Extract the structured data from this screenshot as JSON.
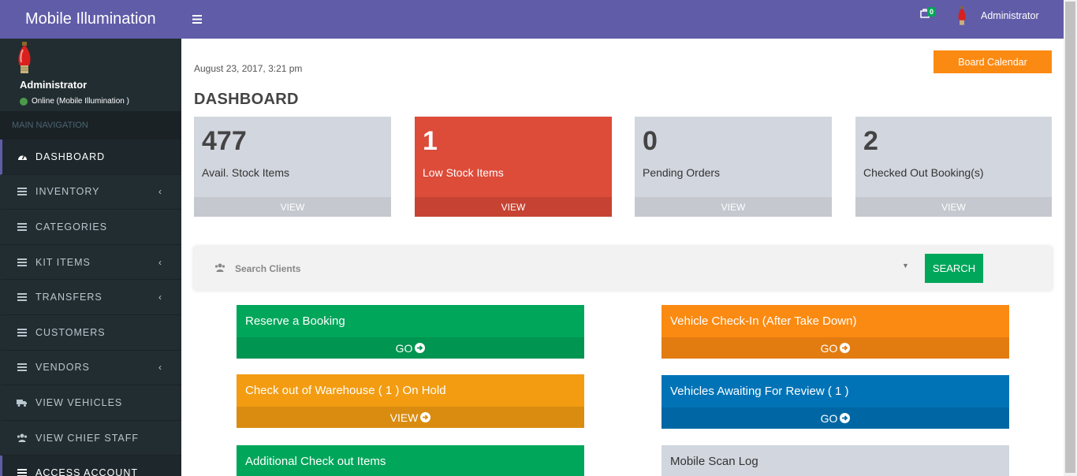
{
  "app": {
    "title": "Mobile Illumination"
  },
  "topbar": {
    "cart_count": "0",
    "user": "Administrator"
  },
  "sidebar": {
    "user_name": "Administrator",
    "status": "Online (Mobile Illumination )",
    "nav_header": "MAIN NAVIGATION",
    "items": [
      {
        "label": "DASHBOARD",
        "icon": "dashboard-icon",
        "active": true,
        "has_children": false
      },
      {
        "label": "INVENTORY",
        "icon": "list-icon",
        "has_children": true
      },
      {
        "label": "CATEGORIES",
        "icon": "list-icon",
        "has_children": false
      },
      {
        "label": "KIT ITEMS",
        "icon": "list-icon",
        "has_children": true
      },
      {
        "label": "TRANSFERS",
        "icon": "list-icon",
        "has_children": true
      },
      {
        "label": "CUSTOMERS",
        "icon": "list-icon",
        "has_children": false
      },
      {
        "label": "VENDORS",
        "icon": "list-icon",
        "has_children": true
      },
      {
        "label": "VIEW VEHICLES",
        "icon": "truck-icon",
        "has_children": false
      },
      {
        "label": "VIEW CHIEF STAFF",
        "icon": "users-icon",
        "has_children": false
      },
      {
        "label": "ACCESS ACCOUNT",
        "icon": "list-icon",
        "has_children": false
      }
    ]
  },
  "main": {
    "date": "August 23, 2017, 3:21 pm",
    "board_calendar": "Board Calendar",
    "title": "DASHBOARD",
    "tiles": [
      {
        "value": "477",
        "label": "Avail. Stock Items",
        "footer": "VIEW"
      },
      {
        "value": "1",
        "label": "Low Stock Items",
        "footer": "VIEW"
      },
      {
        "value": "0",
        "label": "Pending Orders",
        "footer": "VIEW"
      },
      {
        "value": "2",
        "label": "Checked Out Booking(s)",
        "footer": "VIEW"
      }
    ],
    "search": {
      "placeholder": "Search Clients",
      "button": "SEARCH"
    },
    "actions": [
      {
        "title": "Reserve a Booking",
        "footer": "GO"
      },
      {
        "title": "Vehicle Check-In (After Take Down)",
        "footer": "GO"
      },
      {
        "title": "Check out of Warehouse ( 1 ) On Hold",
        "footer": "VIEW"
      },
      {
        "title": "Vehicles Awaiting For Review ( 1 )",
        "footer": "GO"
      },
      {
        "title": "Additional Check out Items",
        "footer": ""
      },
      {
        "title": "Mobile Scan Log",
        "footer": ""
      }
    ]
  },
  "colors": {
    "brand": "#605ca8",
    "sidebar": "#222d32",
    "green": "#00a65a",
    "orange": "#fb8a12",
    "yellow": "#f39c12",
    "blue": "#0073b7",
    "red": "#dd4b39"
  }
}
